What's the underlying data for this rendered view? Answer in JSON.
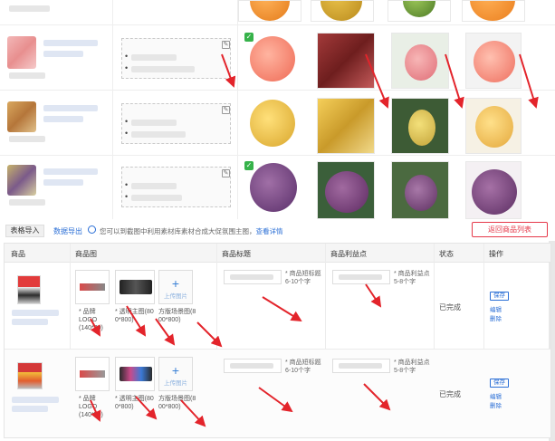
{
  "toolbar": {
    "import_label": "表格导入",
    "export_label": "数据导出",
    "radio_text": "您可以到截图中利用素材库素材合成大促氛围主图，",
    "radio_link": "查看详情",
    "back_label": "返回商品列表"
  },
  "table": {
    "headers": {
      "product": "商品",
      "images": "商品图",
      "title": "商品标题",
      "selling_point": "商品利益点",
      "status": "状态",
      "actions": "操作"
    },
    "rows": [
      {
        "captions": [
          "* 品牌LOGO (140*70)",
          "* 透明主图(80 0*800)",
          "方版场景图(8 00*800)"
        ],
        "upload_label": "上传图片",
        "title_hint": "* 商品短标题 6-10个字",
        "selling_hint": "* 商品利益点 5-8个字",
        "status": "已完成",
        "edit": "保存",
        "link1": "编辑",
        "link2": "删除"
      },
      {
        "captions": [
          "* 品牌LOGO (140*70)",
          "* 透明主图(80 0*800)",
          "方版场景图(8 00*800)"
        ],
        "upload_label": "上传图片",
        "title_hint": "* 商品短标题 6-10个字",
        "selling_hint": "* 商品利益点 5-8个字",
        "status": "已完成",
        "edit": "保存",
        "link1": "编辑",
        "link2": "删除"
      }
    ]
  },
  "colors": {
    "accent_red": "#e6394a",
    "link_blue": "#2b6fd6",
    "check_green": "#36b24a",
    "arrow_red": "#e3242b"
  },
  "icons": [
    "check-icon",
    "edit-icon",
    "plus-icon",
    "radio-icon",
    "arrow-annotation"
  ]
}
